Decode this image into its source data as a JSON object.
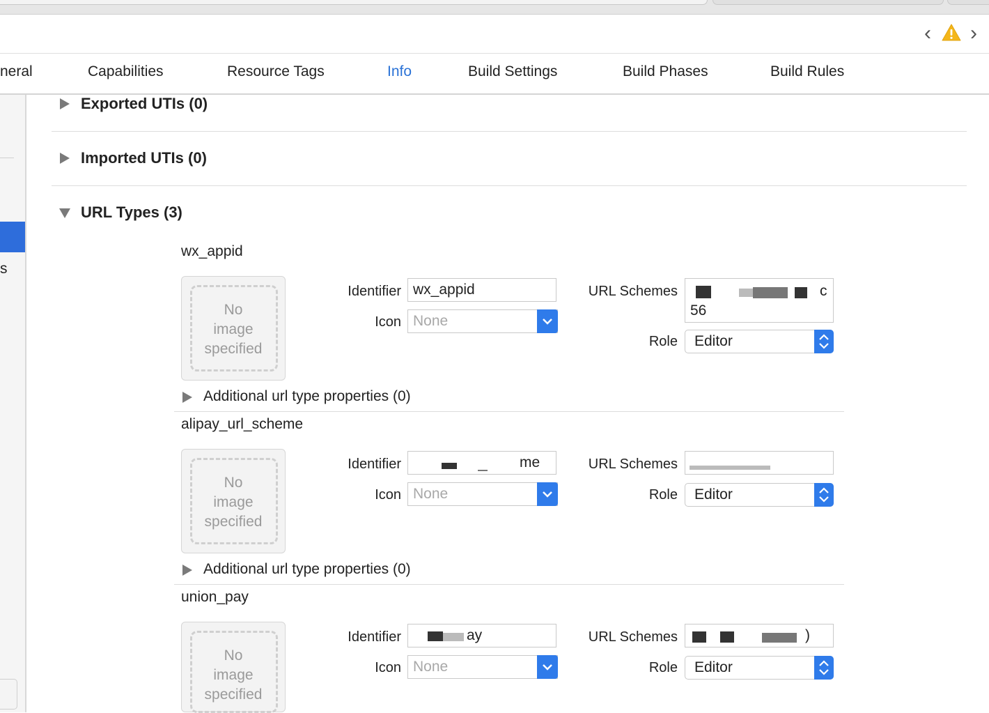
{
  "tabs": [
    {
      "label": "neral"
    },
    {
      "label": "Capabilities"
    },
    {
      "label": "Resource Tags"
    },
    {
      "label": "Info",
      "active": true
    },
    {
      "label": "Build Settings"
    },
    {
      "label": "Build Phases"
    },
    {
      "label": "Build Rules"
    }
  ],
  "toolbar": {
    "back": "‹",
    "forward": "›",
    "warning_icon": "warning-triangle"
  },
  "sidebar": {
    "partial_label": "s"
  },
  "sections": {
    "exported": "Exported UTIs (0)",
    "imported": "Imported UTIs (0)",
    "url_types": "URL Types (3)"
  },
  "url_types": [
    {
      "name": "wx_appid",
      "image_placeholder": [
        "No",
        "image",
        "specified"
      ],
      "identifier_label": "Identifier",
      "identifier": "wx_appid",
      "icon_label": "Icon",
      "icon_placeholder": "None",
      "schemes_label": "URL Schemes",
      "schemes_line1": "wx…c",
      "schemes_line2": "56",
      "role_label": "Role",
      "role": "Editor",
      "additional": "Additional url type properties (0)"
    },
    {
      "name": "alipay_url_scheme",
      "image_placeholder": [
        "No",
        "image",
        "specified"
      ],
      "identifier_label": "Identifier",
      "identifier": "me",
      "icon_label": "Icon",
      "icon_placeholder": "None",
      "schemes_label": "URL Schemes",
      "schemes_line1": "",
      "role_label": "Role",
      "role": "Editor",
      "additional": "Additional url type properties (0)"
    },
    {
      "name": "union_pay",
      "image_placeholder": [
        "No",
        "image",
        "specified"
      ],
      "identifier_label": "Identifier",
      "identifier": "ay",
      "icon_label": "Icon",
      "icon_placeholder": "None",
      "schemes_label": "URL Schemes",
      "schemes_line1": ")",
      "role_label": "Role",
      "role": "Editor"
    }
  ],
  "colors": {
    "accent": "#2f7bea",
    "active_tab": "#2a72d6",
    "sidebar_selection": "#2e6ddb"
  }
}
